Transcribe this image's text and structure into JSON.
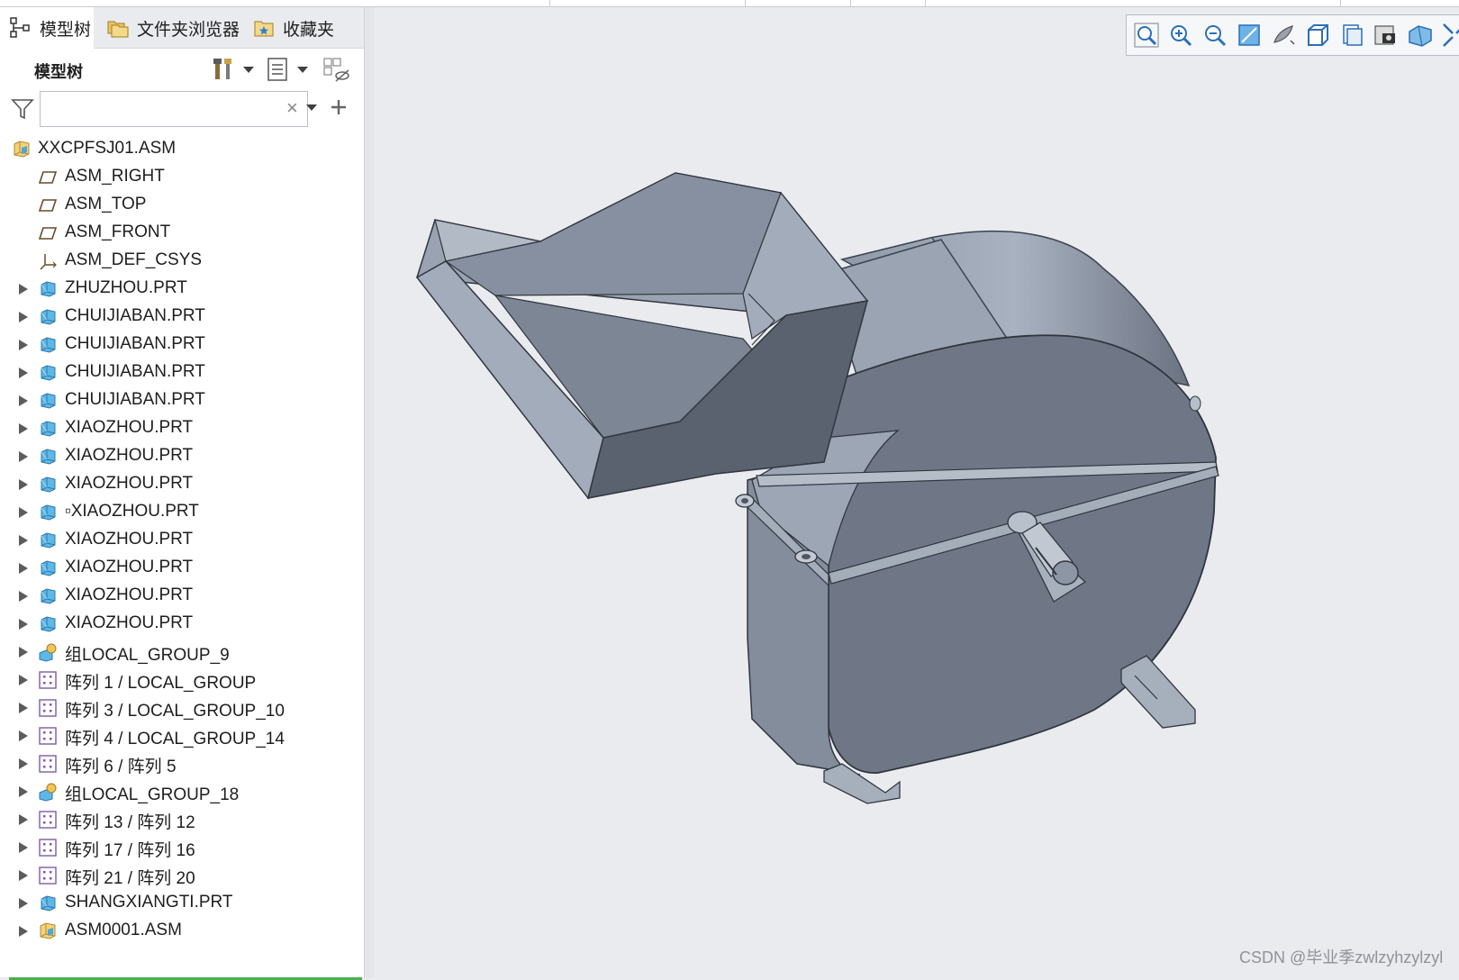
{
  "tabs": [
    {
      "label": "模型树",
      "icon": "model-tree-icon"
    },
    {
      "label": "文件夹浏览器",
      "icon": "folder-browser-icon"
    },
    {
      "label": "收藏夹",
      "icon": "favorites-icon"
    }
  ],
  "panel": {
    "title": "模型树",
    "search": {
      "value": "",
      "placeholder": ""
    }
  },
  "tree": {
    "root": "XXCPFSJ01.ASM",
    "items": [
      {
        "label": "ASM_RIGHT",
        "icon": "datum-plane-icon",
        "expandable": false
      },
      {
        "label": "ASM_TOP",
        "icon": "datum-plane-icon",
        "expandable": false
      },
      {
        "label": "ASM_FRONT",
        "icon": "datum-plane-icon",
        "expandable": false
      },
      {
        "label": "ASM_DEF_CSYS",
        "icon": "coordinate-system-icon",
        "expandable": false
      },
      {
        "label": "ZHUZHOU.PRT",
        "icon": "part-icon",
        "expandable": true
      },
      {
        "label": "CHUIJIABAN.PRT",
        "icon": "part-icon",
        "expandable": true
      },
      {
        "label": "CHUIJIABAN.PRT",
        "icon": "part-icon",
        "expandable": true
      },
      {
        "label": "CHUIJIABAN.PRT",
        "icon": "part-icon",
        "expandable": true
      },
      {
        "label": "CHUIJIABAN.PRT",
        "icon": "part-icon",
        "expandable": true
      },
      {
        "label": "XIAOZHOU.PRT",
        "icon": "part-icon",
        "expandable": true
      },
      {
        "label": "XIAOZHOU.PRT",
        "icon": "part-icon",
        "expandable": true
      },
      {
        "label": "XIAOZHOU.PRT",
        "icon": "part-icon",
        "expandable": true
      },
      {
        "label": "▫XIAOZHOU.PRT",
        "icon": "part-icon",
        "expandable": true
      },
      {
        "label": "XIAOZHOU.PRT",
        "icon": "part-icon",
        "expandable": true
      },
      {
        "label": "XIAOZHOU.PRT",
        "icon": "part-icon",
        "expandable": true
      },
      {
        "label": "XIAOZHOU.PRT",
        "icon": "part-icon",
        "expandable": true
      },
      {
        "label": "XIAOZHOU.PRT",
        "icon": "part-icon",
        "expandable": true
      },
      {
        "label": "组LOCAL_GROUP_9",
        "icon": "group-icon",
        "expandable": true
      },
      {
        "label": "阵列 1 / LOCAL_GROUP",
        "icon": "pattern-icon",
        "expandable": true
      },
      {
        "label": "阵列 3 / LOCAL_GROUP_10",
        "icon": "pattern-icon",
        "expandable": true
      },
      {
        "label": "阵列 4 / LOCAL_GROUP_14",
        "icon": "pattern-icon",
        "expandable": true
      },
      {
        "label": "阵列 6 / 阵列 5",
        "icon": "pattern-icon",
        "expandable": true
      },
      {
        "label": "组LOCAL_GROUP_18",
        "icon": "group-icon",
        "expandable": true
      },
      {
        "label": "阵列 13 / 阵列 12",
        "icon": "pattern-icon",
        "expandable": true
      },
      {
        "label": "阵列 17 / 阵列 16",
        "icon": "pattern-icon",
        "expandable": true
      },
      {
        "label": "阵列 21 / 阵列 20",
        "icon": "pattern-icon",
        "expandable": true
      },
      {
        "label": "SHANGXIANGTI.PRT",
        "icon": "part-icon",
        "expandable": true
      },
      {
        "label": "ASM0001.ASM",
        "icon": "assembly-icon",
        "expandable": true
      }
    ]
  },
  "view_toolbar": [
    "refit-icon",
    "zoom-in-icon",
    "zoom-out-icon",
    "repaint-icon",
    "display-style-icon",
    "saved-orientations-icon",
    "view-manager-icon",
    "perspective-icon",
    "section-icon",
    "annotation-display-icon"
  ],
  "watermark": "CSDN @毕业季zwlzyhzylzyl",
  "colors": {
    "model_face": "#8a94a3",
    "model_dark": "#5f6775",
    "model_light": "#a9b2bf",
    "part_icon": "#4aa7d9",
    "accent_green": "#4caf50"
  }
}
